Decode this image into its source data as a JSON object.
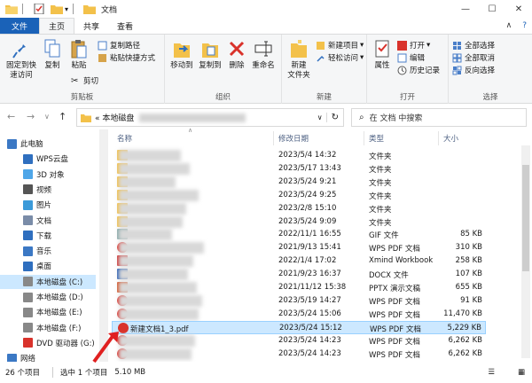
{
  "window": {
    "title": "文档",
    "minimize": "—",
    "maximize": "☐",
    "close": "✕"
  },
  "ribbon_tabs": {
    "file": "文件",
    "home": "主页",
    "share": "共享",
    "view": "查看"
  },
  "ribbon": {
    "pin_quick": "固定到快\n速访问",
    "copy": "复制",
    "paste": "粘贴",
    "copy_path": "复制路径",
    "paste_shortcut": "粘贴快捷方式",
    "cut": "剪切",
    "clipboard_group": "剪贴板",
    "move_to": "移动到",
    "copy_to": "复制到",
    "delete": "删除",
    "rename": "重命名",
    "organize_group": "组织",
    "new_folder": "新建\n文件夹",
    "new_item": "新建项目",
    "easy_access": "轻松访问",
    "new_group": "新建",
    "properties": "属性",
    "open": "打开",
    "edit": "编辑",
    "history": "历史记录",
    "open_group": "打开",
    "select_all": "全部选择",
    "select_none": "全部取消",
    "invert_selection": "反向选择",
    "select_group": "选择"
  },
  "address": {
    "back": "←",
    "forward": "→",
    "recent": "∨",
    "up": "↑",
    "path_prefix": "« 本地磁盘",
    "dropdown": "∨",
    "refresh": "↻",
    "search_placeholder": "在 文档 中搜索"
  },
  "nav": [
    {
      "label": "此电脑",
      "icon": "computer-icon",
      "indent": 8
    },
    {
      "label": "WPS云盘",
      "icon": "cloud-icon",
      "indent": 26
    },
    {
      "label": "3D 对象",
      "icon": "cube-icon",
      "indent": 26
    },
    {
      "label": "视频",
      "icon": "video-icon",
      "indent": 26
    },
    {
      "label": "图片",
      "icon": "picture-icon",
      "indent": 26
    },
    {
      "label": "文档",
      "icon": "document-icon",
      "indent": 26
    },
    {
      "label": "下载",
      "icon": "download-icon",
      "indent": 26
    },
    {
      "label": "音乐",
      "icon": "music-icon",
      "indent": 26
    },
    {
      "label": "桌面",
      "icon": "desktop-icon",
      "indent": 26
    },
    {
      "label": "本地磁盘 (C:)",
      "icon": "drive-icon",
      "indent": 26,
      "selected": true
    },
    {
      "label": "本地磁盘 (D:)",
      "icon": "drive-icon",
      "indent": 26
    },
    {
      "label": "本地磁盘 (E:)",
      "icon": "drive-icon",
      "indent": 26
    },
    {
      "label": "本地磁盘 (F:)",
      "icon": "drive-icon",
      "indent": 26
    },
    {
      "label": "DVD 驱动器 (G:)",
      "icon": "dvd-icon",
      "indent": 26
    },
    {
      "label": "网络",
      "icon": "network-icon",
      "indent": 8
    }
  ],
  "columns": {
    "name": "名称",
    "modified": "修改日期",
    "type": "类型",
    "size": "大小"
  },
  "files": [
    {
      "name": "",
      "modified": "2023/5/4 14:32",
      "type": "文件夹",
      "size": "",
      "icon": "folder-icon"
    },
    {
      "name": "",
      "modified": "2023/5/17 13:43",
      "type": "文件夹",
      "size": "",
      "icon": "folder-icon"
    },
    {
      "name": "",
      "modified": "2023/5/24 9:21",
      "type": "文件夹",
      "size": "",
      "icon": "folder-icon"
    },
    {
      "name": "",
      "modified": "2023/5/24 9:25",
      "type": "文件夹",
      "size": "",
      "icon": "folder-icon"
    },
    {
      "name": "",
      "modified": "2023/2/8 15:10",
      "type": "文件夹",
      "size": "",
      "icon": "folder-icon"
    },
    {
      "name": "",
      "modified": "2023/5/24 9:09",
      "type": "文件夹",
      "size": "",
      "icon": "folder-icon"
    },
    {
      "name": "",
      "modified": "2022/11/1 16:55",
      "type": "GIF 文件",
      "size": "85 KB",
      "icon": "gif-icon"
    },
    {
      "name": "",
      "modified": "2021/9/13 15:41",
      "type": "WPS PDF 文档",
      "size": "310 KB",
      "icon": "pdf-icon"
    },
    {
      "name": "",
      "modified": "2022/1/4 17:02",
      "type": "Xmind Workbook",
      "size": "258 KB",
      "icon": "xmind-icon"
    },
    {
      "name": "",
      "modified": "2021/9/23 16:37",
      "type": "DOCX 文件",
      "size": "107 KB",
      "icon": "docx-icon"
    },
    {
      "name": "",
      "modified": "2021/11/12 15:38",
      "type": "PPTX 演示文稿",
      "size": "655 KB",
      "icon": "pptx-icon"
    },
    {
      "name": "",
      "modified": "2023/5/19 14:27",
      "type": "WPS PDF 文档",
      "size": "91 KB",
      "icon": "pdf-icon"
    },
    {
      "name": "",
      "modified": "2023/5/24 15:06",
      "type": "WPS PDF 文档",
      "size": "11,470 KB",
      "icon": "pdf-icon"
    },
    {
      "name": "新建文档1_3.pdf",
      "modified": "2023/5/24 15:12",
      "type": "WPS PDF 文档",
      "size": "5,229 KB",
      "icon": "pdf-icon",
      "selected": true
    },
    {
      "name": "",
      "modified": "2023/5/24 14:23",
      "type": "WPS PDF 文档",
      "size": "6,262 KB",
      "icon": "pdf-icon"
    },
    {
      "name": "",
      "modified": "2023/5/24 14:23",
      "type": "WPS PDF 文档",
      "size": "6,262 KB",
      "icon": "pdf-icon"
    }
  ],
  "status": {
    "count": "26 个项目",
    "selected": "选中 1 个项目",
    "size": "5.10 MB"
  },
  "colors": {
    "accent": "#1a62b8",
    "selection": "#cce8ff",
    "folder": "#f3c14a",
    "pdf_red": "#d9322b",
    "arrow_red": "#e02020"
  }
}
